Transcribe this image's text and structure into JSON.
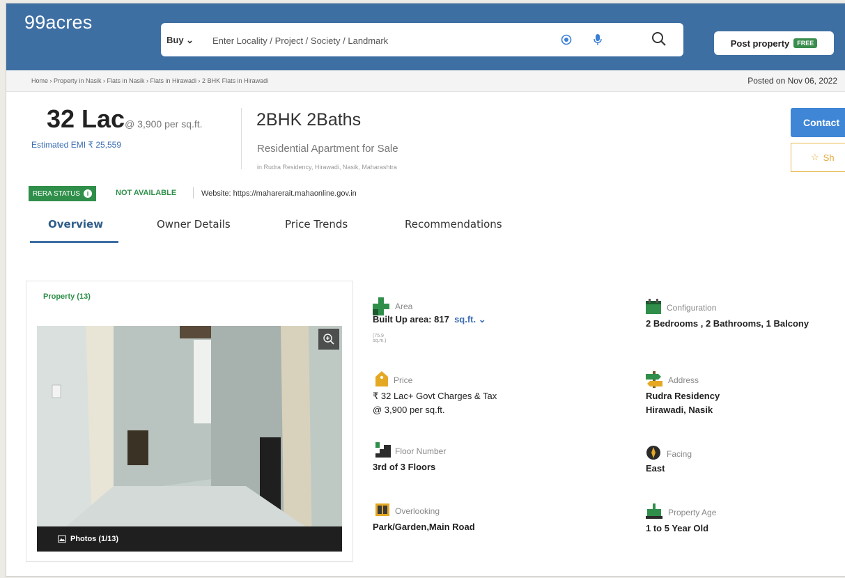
{
  "header": {
    "logo": "99acres",
    "buy_label": "Buy",
    "search_placeholder": "Enter Locality / Project / Society / Landmark",
    "post_property_label": "Post property",
    "free_badge": "FREE",
    "brand_color": "#3e6fa3"
  },
  "breadcrumb": {
    "text": "Home › Property in Nasik › Flats in Nasik › Flats in Hirawadi › 2 BHK Flats in Hirawadi",
    "posted": "Posted on Nov 06, 2022"
  },
  "listing": {
    "price": "32 Lac",
    "price_per_sqft": "@ 3,900 per sq.ft.",
    "emi": "Estimated EMI ₹ 25,559",
    "title": "2BHK 2Baths",
    "subtitle": "Residential Apartment for Sale",
    "location": "in Rudra Residency, Hirawadi, Nasik, Maharashtra",
    "contact_label": "Contact",
    "shortlist_label": "Sh"
  },
  "rera": {
    "badge": "RERA STATUS",
    "status": "NOT AVAILABLE",
    "website": "Website: https://maharerait.mahaonline.gov.in"
  },
  "tabs": [
    {
      "label": "Overview",
      "active": true
    },
    {
      "label": "Owner Details",
      "active": false
    },
    {
      "label": "Price Trends",
      "active": false
    },
    {
      "label": "Recommendations",
      "active": false
    }
  ],
  "property": {
    "title": "Property (13)",
    "photos_label": "Photos (1/13)"
  },
  "details": {
    "area": {
      "label": "Area",
      "value": "Built Up area: 817",
      "unit": "sq.ft.",
      "sub": "(75.9 sq.m.)"
    },
    "configuration": {
      "label": "Configuration",
      "value": "2 Bedrooms , 2 Bathrooms, 1 Balcony"
    },
    "price": {
      "label": "Price",
      "value": "₹ 32 Lac+ Govt Charges & Tax",
      "value2": "@ 3,900 per sq.ft."
    },
    "address": {
      "label": "Address",
      "value": "Rudra Residency",
      "value2": "Hirawadi, Nasik"
    },
    "floor": {
      "label": "Floor Number",
      "value": "3rd  of 3 Floors"
    },
    "facing": {
      "label": "Facing",
      "value": "East"
    },
    "overlooking": {
      "label": "Overlooking",
      "value": "Park/Garden,Main Road"
    },
    "age": {
      "label": "Property Age",
      "value": "1 to 5 Year Old"
    }
  }
}
